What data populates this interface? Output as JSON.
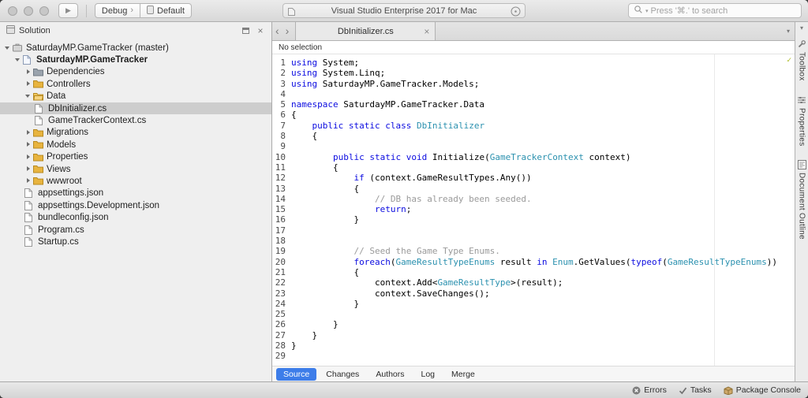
{
  "window": {
    "title": "Visual Studio Enterprise 2017 for Mac",
    "search_placeholder": "Press '⌘.' to search"
  },
  "toolbar": {
    "configuration": "Debug",
    "target": "Default"
  },
  "icons": {
    "run": "▶",
    "back": "‹",
    "forward": "›",
    "config-chevron": "›",
    "tab-overflow": "▾",
    "close": "×",
    "strip-collapse": "▾",
    "search-dropdown": "▾"
  },
  "sidebar": {
    "title": "Solution",
    "tree": [
      {
        "label": "SaturdayMP.GameTracker (master)",
        "depth": 0,
        "icon": "solution",
        "state": "expanded",
        "bold": false,
        "selected": false
      },
      {
        "label": "SaturdayMP.GameTracker",
        "depth": 1,
        "icon": "project",
        "state": "expanded",
        "bold": true,
        "selected": false
      },
      {
        "label": "Dependencies",
        "depth": 2,
        "icon": "dependencies",
        "state": "collapsed",
        "bold": false,
        "selected": false
      },
      {
        "label": "Controllers",
        "depth": 2,
        "icon": "folder",
        "state": "collapsed",
        "bold": false,
        "selected": false
      },
      {
        "label": "Data",
        "depth": 2,
        "icon": "folder-open",
        "state": "expanded",
        "bold": false,
        "selected": false
      },
      {
        "label": "DbInitializer.cs",
        "depth": 3,
        "icon": "file-cs",
        "state": "leaf",
        "bold": false,
        "selected": true
      },
      {
        "label": "GameTrackerContext.cs",
        "depth": 3,
        "icon": "file-cs",
        "state": "leaf",
        "bold": false,
        "selected": false
      },
      {
        "label": "Migrations",
        "depth": 2,
        "icon": "folder",
        "state": "collapsed",
        "bold": false,
        "selected": false
      },
      {
        "label": "Models",
        "depth": 2,
        "icon": "folder",
        "state": "collapsed",
        "bold": false,
        "selected": false
      },
      {
        "label": "Properties",
        "depth": 2,
        "icon": "folder",
        "state": "collapsed",
        "bold": false,
        "selected": false
      },
      {
        "label": "Views",
        "depth": 2,
        "icon": "folder",
        "state": "collapsed",
        "bold": false,
        "selected": false
      },
      {
        "label": "wwwroot",
        "depth": 2,
        "icon": "folder",
        "state": "collapsed",
        "bold": false,
        "selected": false
      },
      {
        "label": "appsettings.json",
        "depth": 2,
        "icon": "file-json",
        "state": "leaf",
        "bold": false,
        "selected": false
      },
      {
        "label": "appsettings.Development.json",
        "depth": 2,
        "icon": "file-json",
        "state": "leaf",
        "bold": false,
        "selected": false
      },
      {
        "label": "bundleconfig.json",
        "depth": 2,
        "icon": "file-json",
        "state": "leaf",
        "bold": false,
        "selected": false
      },
      {
        "label": "Program.cs",
        "depth": 2,
        "icon": "file-cs",
        "state": "leaf",
        "bold": false,
        "selected": false
      },
      {
        "label": "Startup.cs",
        "depth": 2,
        "icon": "file-cs",
        "state": "leaf",
        "bold": false,
        "selected": false
      }
    ]
  },
  "editor": {
    "tab_label": "DbInitializer.cs",
    "breadcrumb": "No selection",
    "footer_tabs": [
      {
        "label": "Source",
        "active": true
      },
      {
        "label": "Changes",
        "active": false
      },
      {
        "label": "Authors",
        "active": false
      },
      {
        "label": "Log",
        "active": false
      },
      {
        "label": "Merge",
        "active": false
      }
    ],
    "code_lines": [
      [
        [
          "k",
          "using"
        ],
        [
          "p",
          " System;"
        ]
      ],
      [
        [
          "k",
          "using"
        ],
        [
          "p",
          " System.Linq;"
        ]
      ],
      [
        [
          "k",
          "using"
        ],
        [
          "p",
          " SaturdayMP.GameTracker.Models;"
        ]
      ],
      [],
      [
        [
          "k",
          "namespace"
        ],
        [
          "p",
          " SaturdayMP.GameTracker.Data"
        ]
      ],
      [
        [
          "p",
          "{"
        ]
      ],
      [
        [
          "p",
          "    "
        ],
        [
          "k",
          "public"
        ],
        [
          "p",
          " "
        ],
        [
          "k",
          "static"
        ],
        [
          "p",
          " "
        ],
        [
          "k",
          "class"
        ],
        [
          "p",
          " "
        ],
        [
          "t",
          "DbInitializer"
        ]
      ],
      [
        [
          "p",
          "    {"
        ]
      ],
      [],
      [
        [
          "p",
          "        "
        ],
        [
          "k",
          "public"
        ],
        [
          "p",
          " "
        ],
        [
          "k",
          "static"
        ],
        [
          "p",
          " "
        ],
        [
          "k",
          "void"
        ],
        [
          "p",
          " Initialize("
        ],
        [
          "t",
          "GameTrackerContext"
        ],
        [
          "p",
          " context)"
        ]
      ],
      [
        [
          "p",
          "        {"
        ]
      ],
      [
        [
          "p",
          "            "
        ],
        [
          "k",
          "if"
        ],
        [
          "p",
          " (context.GameResultTypes.Any())"
        ]
      ],
      [
        [
          "p",
          "            {"
        ]
      ],
      [
        [
          "p",
          "                "
        ],
        [
          "c",
          "// DB has already been seeded."
        ]
      ],
      [
        [
          "p",
          "                "
        ],
        [
          "k",
          "return"
        ],
        [
          "p",
          ";"
        ]
      ],
      [
        [
          "p",
          "            }"
        ]
      ],
      [],
      [],
      [
        [
          "p",
          "            "
        ],
        [
          "c",
          "// Seed the Game Type Enums."
        ]
      ],
      [
        [
          "p",
          "            "
        ],
        [
          "k",
          "foreach"
        ],
        [
          "p",
          "("
        ],
        [
          "t",
          "GameResultTypeEnums"
        ],
        [
          "p",
          " result "
        ],
        [
          "k",
          "in"
        ],
        [
          "p",
          " "
        ],
        [
          "t",
          "Enum"
        ],
        [
          "p",
          ".GetValues("
        ],
        [
          "k",
          "typeof"
        ],
        [
          "p",
          "("
        ],
        [
          "t",
          "GameResultTypeEnums"
        ],
        [
          "p",
          "))"
        ]
      ],
      [
        [
          "p",
          "            {"
        ]
      ],
      [
        [
          "p",
          "                context.Add<"
        ],
        [
          "t",
          "GameResultType"
        ],
        [
          "p",
          ">(result);"
        ]
      ],
      [
        [
          "p",
          "                context.SaveChanges();"
        ]
      ],
      [
        [
          "p",
          "            }"
        ]
      ],
      [],
      [
        [
          "p",
          "        }"
        ]
      ],
      [
        [
          "p",
          "    }"
        ]
      ],
      [
        [
          "p",
          "}"
        ]
      ],
      []
    ]
  },
  "right_panel": {
    "tabs": [
      "Toolbox",
      "Properties",
      "Document Outline"
    ]
  },
  "statusbar": {
    "items": [
      {
        "icon": "errors-icon",
        "label": "Errors"
      },
      {
        "icon": "tasks-icon",
        "label": "Tasks"
      },
      {
        "icon": "package-console-icon",
        "label": "Package Console"
      }
    ]
  },
  "colors": {
    "keyword": "#0b0be0",
    "type": "#2b91af",
    "comment": "#9a9a9a",
    "accent": "#3d7de9",
    "folder": "#e8b43f",
    "tree_selection": "#cdcdcd"
  }
}
